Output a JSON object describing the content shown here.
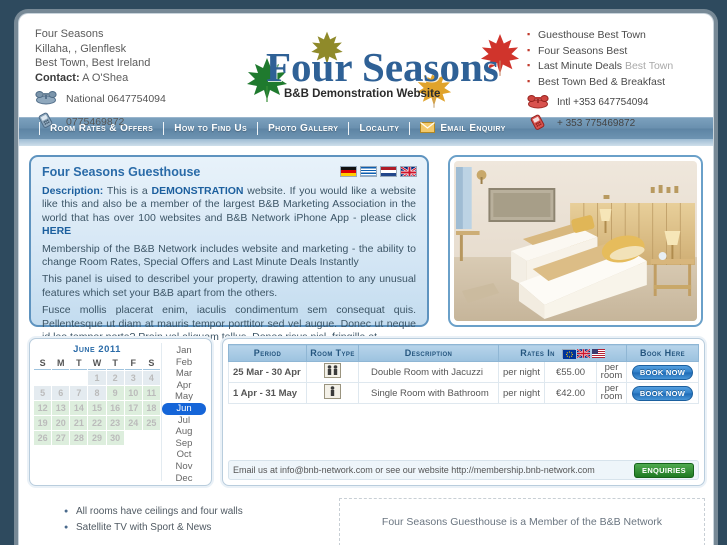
{
  "header": {
    "business_name": "Four Seasons",
    "address_line1": "Killaha, , Glenflesk",
    "address_line2": "Best Town, Best Ireland",
    "contact_label": "Contact",
    "contact_name": "A O'Shea",
    "phone_national_label": "National 0647754094",
    "phone_mobile_label": "0775469872",
    "logo_word": "Four Seasons",
    "logo_sub": "B&B Demonstration Website",
    "links": [
      {
        "text": "Guesthouse Best Town",
        "muted": ""
      },
      {
        "text": "Four Seasons Best",
        "muted": ""
      },
      {
        "text": "Last Minute Deals ",
        "muted": "Best Town"
      },
      {
        "text": "Best Town Bed & Breakfast",
        "muted": ""
      }
    ],
    "phone_intl_label": "Intl +353 647754094",
    "phone_intl_mobile_label": "+ 353 775469872",
    "accent_red": "#c0392b",
    "accent_blue": "#2f6196"
  },
  "nav": {
    "items": [
      {
        "label": "Room Rates & Offers",
        "icon": ""
      },
      {
        "label": "How to Find Us",
        "icon": ""
      },
      {
        "label": "Photo Gallery",
        "icon": ""
      },
      {
        "label": "Locality",
        "icon": ""
      },
      {
        "label": "Email Enquiry",
        "icon": "envelope-icon"
      }
    ]
  },
  "description": {
    "title": "Four Seasons Guesthouse",
    "label": "Description:",
    "lead_before": " This is a ",
    "demo_word": "DEMONSTRATION",
    "lead_after": " website. If you would like a website like this and also be a member of the largest B&B Marketing Association in the world that has over 100 websites and B&B Network iPhone App - please click ",
    "here_link": "HERE",
    "para2": "Membership of the B&B Network includes website and marketing - the ability to change Room Rates, Special Offers and Last Minute Deals Instantly",
    "para3": "This panel is uised to describel your property, drawing attention to any unusual features which set your B&B apart from the others.",
    "para4": "Fusce mollis placerat enim, iaculis condimentum sem consequat quis. Pellentesque ut diam at mauris tempor porttitor sed vel augue. Donec ut neque id leo tempor porta? Proin vel aliquam tellus. Donec risus nisl, fringilla et",
    "flags": [
      "germany-flag",
      "greece-flag",
      "netherlands-flag",
      "uk-flag"
    ]
  },
  "photo": {
    "alt": "guest-bedroom-photo"
  },
  "calendar": {
    "month_label": "June 2011",
    "weekdays": [
      "S",
      "M",
      "T",
      "W",
      "T",
      "F",
      "S"
    ],
    "weeks": [
      [
        {
          "d": "",
          "s": "empty"
        },
        {
          "d": "",
          "s": "empty"
        },
        {
          "d": "",
          "s": "empty"
        },
        {
          "d": "1",
          "s": "past"
        },
        {
          "d": "2",
          "s": "past"
        },
        {
          "d": "3",
          "s": "past"
        },
        {
          "d": "4",
          "s": "past"
        }
      ],
      [
        {
          "d": "5",
          "s": "past"
        },
        {
          "d": "6",
          "s": "past"
        },
        {
          "d": "7",
          "s": "past"
        },
        {
          "d": "8",
          "s": "past"
        },
        {
          "d": "9",
          "s": "avail"
        },
        {
          "d": "10",
          "s": "avail"
        },
        {
          "d": "11",
          "s": "avail"
        }
      ],
      [
        {
          "d": "12",
          "s": "avail"
        },
        {
          "d": "13",
          "s": "avail"
        },
        {
          "d": "14",
          "s": "avail"
        },
        {
          "d": "15",
          "s": "avail"
        },
        {
          "d": "16",
          "s": "avail"
        },
        {
          "d": "17",
          "s": "avail"
        },
        {
          "d": "18",
          "s": "avail"
        }
      ],
      [
        {
          "d": "19",
          "s": "avail"
        },
        {
          "d": "20",
          "s": "avail"
        },
        {
          "d": "21",
          "s": "avail"
        },
        {
          "d": "22",
          "s": "avail"
        },
        {
          "d": "23",
          "s": "avail"
        },
        {
          "d": "24",
          "s": "avail"
        },
        {
          "d": "25",
          "s": "avail"
        }
      ],
      [
        {
          "d": "26",
          "s": "avail"
        },
        {
          "d": "27",
          "s": "avail"
        },
        {
          "d": "28",
          "s": "avail"
        },
        {
          "d": "29",
          "s": "avail"
        },
        {
          "d": "30",
          "s": "avail"
        },
        {
          "d": "",
          "s": "empty"
        },
        {
          "d": "",
          "s": "empty"
        }
      ]
    ],
    "months": [
      "Jan",
      "Feb",
      "Mar",
      "Apr",
      "May",
      "Jun",
      "Jul",
      "Aug",
      "Sep",
      "Oct",
      "Nov",
      "Dec"
    ],
    "selected_month": "Jun",
    "selected_color": "#1565d8"
  },
  "rates": {
    "columns": [
      "Period",
      "Room Type",
      "Description",
      "Rates In",
      "Book Here"
    ],
    "rates_flags": [
      "eu-flag",
      "uk-flag",
      "us-flag"
    ],
    "rows": [
      {
        "period": "25 Mar - 30 Apr",
        "room_icon": "two-person-icon",
        "description": "Double Room with Jacuzzi",
        "per": "per night",
        "price": "€55.00",
        "unit": "per room",
        "book_label": "BOOK NOW"
      },
      {
        "period": "1 Apr - 31 May",
        "room_icon": "one-person-icon",
        "description": "Single Room with Bathroom",
        "per": "per night",
        "price": "€42.00",
        "unit": "per room",
        "book_label": "BOOK NOW"
      }
    ],
    "footer_text": "Email us at info@bnb-network.com or see our website http://membership.bnb-network.com",
    "enquiries_label": "ENQUIRIES"
  },
  "footer": {
    "features": [
      "All rooms have ceilings and four walls",
      "Satellite TV with Sport & News"
    ],
    "member_text": "Four Seasons Guesthouse is a Member of the B&B Network"
  }
}
